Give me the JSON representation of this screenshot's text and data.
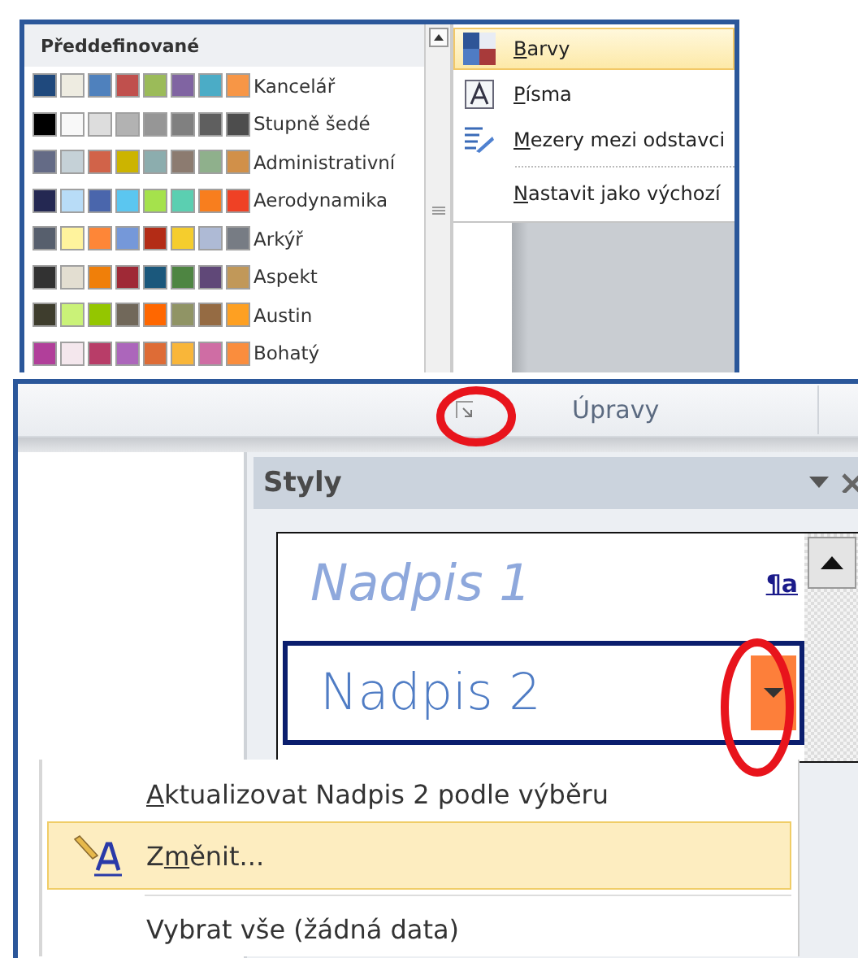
{
  "gallery": {
    "header": "Předdefinované",
    "themes": [
      {
        "name": "Kancelář",
        "swatches": [
          {
            "color": "#1f497d"
          },
          {
            "color": "#eeece1"
          },
          {
            "color": "#4f81bd"
          },
          {
            "color": "#c0504d"
          },
          {
            "color": "#9bbb59"
          },
          {
            "color": "#8064a2"
          },
          {
            "color": "#4bacc6"
          },
          {
            "color": "#f79646"
          }
        ]
      },
      {
        "name": "Stupně šedé",
        "swatches": [
          {
            "color": "#000000"
          },
          {
            "color": "#f8f8f8"
          },
          {
            "color": "#dddddd"
          },
          {
            "color": "#b2b2b2"
          },
          {
            "color": "#969696"
          },
          {
            "color": "#808080"
          },
          {
            "color": "#5f5f5f"
          },
          {
            "color": "#4d4d4d"
          }
        ]
      },
      {
        "name": "Administrativní",
        "swatches": [
          {
            "color": "#646b86"
          },
          {
            "color": "#c5d1d7"
          },
          {
            "color": "#d16349"
          },
          {
            "color": "#ccb400"
          },
          {
            "color": "#8cadae"
          },
          {
            "color": "#8c7b70"
          },
          {
            "color": "#8fb08c"
          },
          {
            "color": "#d19049"
          }
        ]
      },
      {
        "name": "Aerodynamika",
        "swatches": [
          {
            "color": "#242852"
          },
          {
            "color": "#b8dcf7"
          },
          {
            "color": "#4a66ac"
          },
          {
            "color": "#5bc6f0"
          },
          {
            "color": "#a5e24c"
          },
          {
            "color": "#5bcfb1"
          },
          {
            "color": "#f87e1e"
          },
          {
            "color": "#ef4125"
          }
        ]
      },
      {
        "name": "Arkýř",
        "swatches": [
          {
            "color": "#575f6d"
          },
          {
            "color": "#fff39d"
          },
          {
            "color": "#fe8637"
          },
          {
            "color": "#7598d9"
          },
          {
            "color": "#b32c16"
          },
          {
            "color": "#f5cd2d"
          },
          {
            "color": "#aebad5"
          },
          {
            "color": "#777c84"
          }
        ]
      },
      {
        "name": "Aspekt",
        "swatches": [
          {
            "color": "#323232"
          },
          {
            "color": "#e3ded1"
          },
          {
            "color": "#f07f09"
          },
          {
            "color": "#9f2936"
          },
          {
            "color": "#1b587c"
          },
          {
            "color": "#4e8542"
          },
          {
            "color": "#604878"
          },
          {
            "color": "#c19859"
          }
        ]
      },
      {
        "name": "Austin",
        "swatches": [
          {
            "color": "#3e3d2d"
          },
          {
            "color": "#caf278"
          },
          {
            "color": "#94c600"
          },
          {
            "color": "#71685a"
          },
          {
            "color": "#ff6700"
          },
          {
            "color": "#909465"
          },
          {
            "color": "#956b43"
          },
          {
            "color": "#fea022"
          }
        ]
      },
      {
        "name": "Bohatý",
        "swatches": [
          {
            "color": "#b13f9a"
          },
          {
            "color": "#f4e7ed"
          },
          {
            "color": "#b83d68"
          },
          {
            "color": "#ac66bb"
          },
          {
            "color": "#de6c36"
          },
          {
            "color": "#f9b639"
          },
          {
            "color": "#cf6da4"
          },
          {
            "color": "#fa8d3d"
          }
        ]
      }
    ]
  },
  "theme_menu": [
    {
      "kind": "colors",
      "key": "B",
      "post": "arvy",
      "selected": true
    },
    {
      "kind": "fonts",
      "key": "P",
      "post": "ísma",
      "selected": false
    },
    {
      "kind": "spacing",
      "key": "M",
      "post": "ezery mezi odstavci",
      "selected": false
    },
    {
      "kind": "plain",
      "key": "N",
      "post": "astavit jako výchozí",
      "selected": false
    }
  ],
  "ribbon": {
    "group_label": "Úpravy"
  },
  "styles_pane": {
    "title": "Styly",
    "items": [
      {
        "label": "Nadpis 1",
        "italic": true,
        "mark": "¶a",
        "selected": false
      },
      {
        "label": "Nadpis 2",
        "italic": false,
        "selected": true
      }
    ]
  },
  "context_menu": [
    {
      "kind": "plain",
      "key": "A",
      "post": "ktualizovat Nadpis 2 podle výběru",
      "selected": false
    },
    {
      "kind": "modify",
      "pre": "Z",
      "key": "m",
      "post": "ěnit...",
      "selected": true
    },
    {
      "kind": "plain",
      "pre": "Vybrat vše (žádná data)",
      "selected": false
    }
  ]
}
